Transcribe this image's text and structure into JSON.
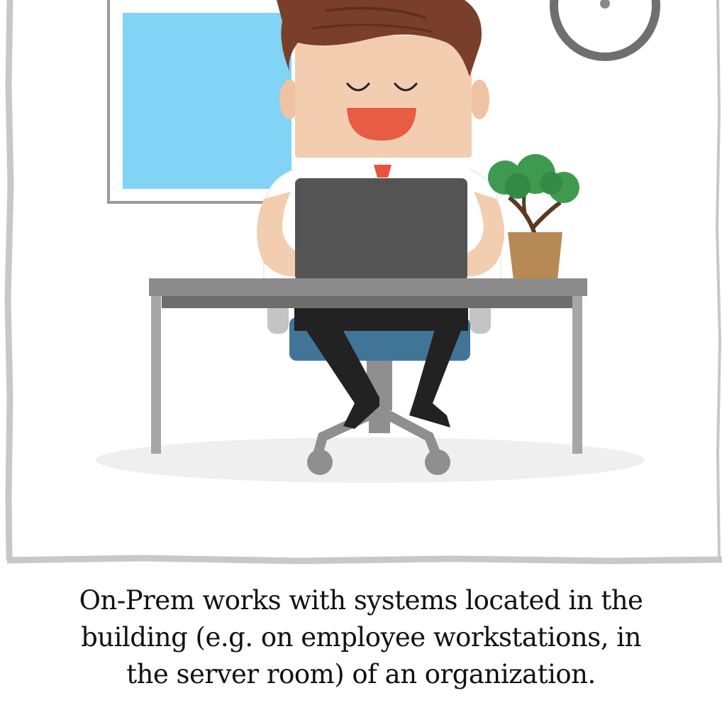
{
  "caption": {
    "lines": [
      "On-Prem works with systems located in the",
      "building (e.g. on employee workstations, in",
      "the server room) of an organization."
    ]
  },
  "illustration": {
    "subject": "office-worker-at-laptop-icon",
    "colors": {
      "window_glass": "#81d4f5",
      "hair": "#7a3f2a",
      "skin": "#f3cdb0",
      "mouth": "#e85c43",
      "tie": "#e8533f",
      "laptop": "#545454",
      "desk_top": "#8c8c8c",
      "chair_seat": "#417597",
      "plant_leaves": "#3e9a4f",
      "pot": "#b78a55",
      "floor_shadow": "#efefef",
      "frame_border": "#c8c8c8"
    }
  }
}
